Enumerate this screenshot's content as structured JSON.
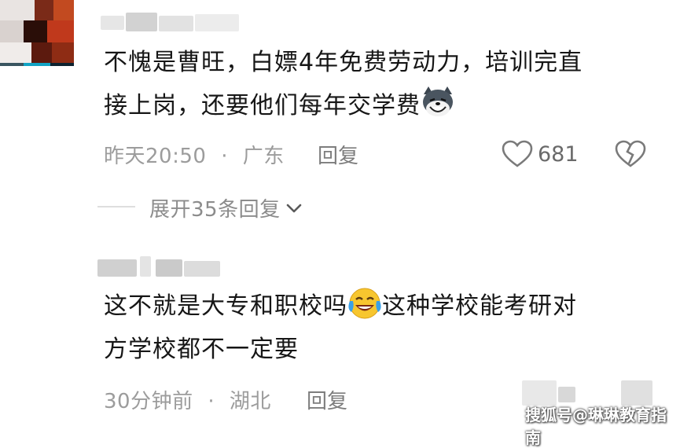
{
  "comments": [
    {
      "text_line1": "不愧是曹旺，白嫖4年免费劳动力，培训完直",
      "text_line2": "接上岗，还要他们每年交学费",
      "emoji_icon": "wolf-grin-emoji",
      "time": "昨天20:50",
      "location": "广东",
      "separator": "·",
      "reply_label": "回复",
      "like_count": "681",
      "expand_label": "展开35条回复"
    },
    {
      "text_line1_a": "这不就是大专和职校吗",
      "emoji_icon": "crying-laughing-emoji",
      "text_line1_b": "这种学校能考研对",
      "text_line2": "方学校都不一定要",
      "time": "30分钟前",
      "location": "湖北",
      "separator": "·",
      "reply_label": "回复"
    }
  ],
  "watermark": "搜狐号@琳琳教育指南",
  "colors": {
    "text": "#161616",
    "meta": "#9c9c9c",
    "divider": "#dedede"
  }
}
